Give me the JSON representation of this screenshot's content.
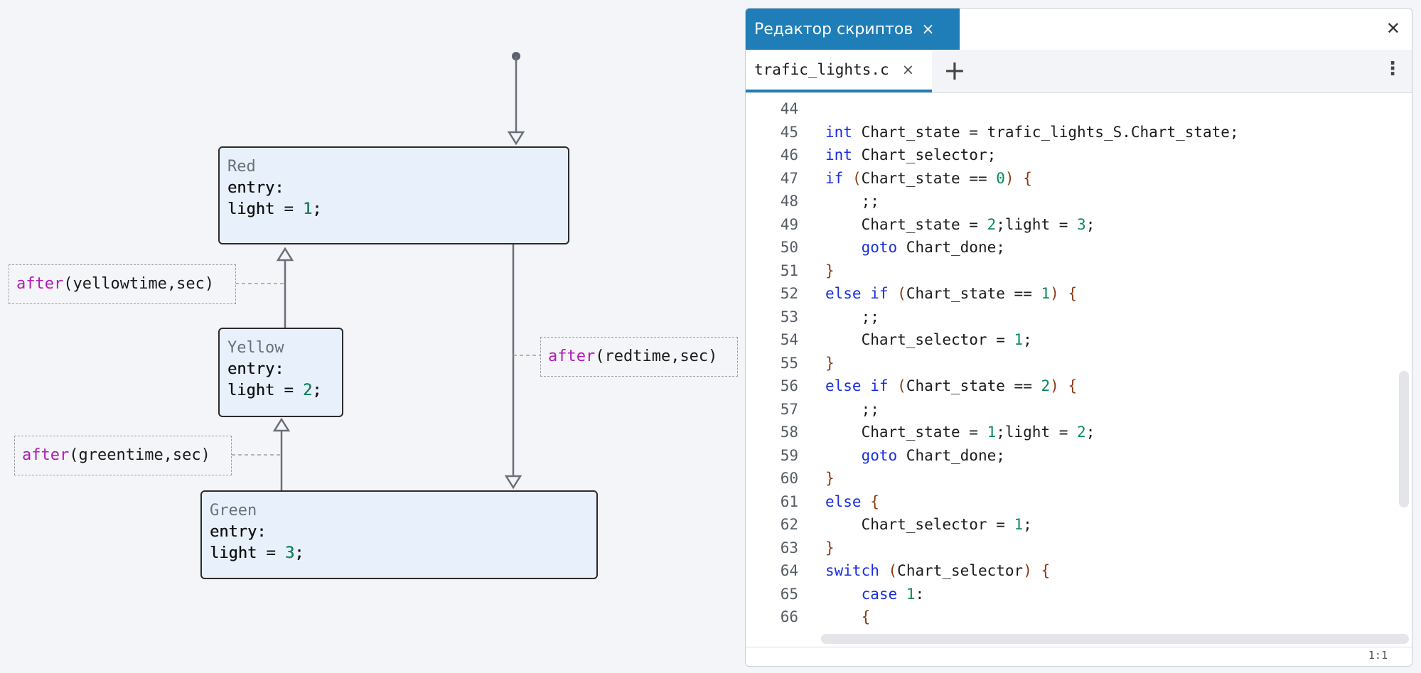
{
  "diagram": {
    "states": [
      {
        "name": "Red",
        "entry": "entry:",
        "action_prefix": "light = ",
        "action_value": "1",
        "action_suffix": ";"
      },
      {
        "name": "Yellow",
        "entry": "entry:",
        "action_prefix": "light = ",
        "action_value": "2",
        "action_suffix": ";"
      },
      {
        "name": "Green",
        "entry": "entry:",
        "action_prefix": "light = ",
        "action_value": "3",
        "action_suffix": ";"
      }
    ],
    "transitions": [
      {
        "keyword": "after",
        "args": "(yellowtime,sec)"
      },
      {
        "keyword": "after",
        "args": "(redtime,sec)"
      },
      {
        "keyword": "after",
        "args": "(greentime,sec)"
      }
    ]
  },
  "editor": {
    "title": "Редактор скриптов",
    "title_close_icon": "×",
    "window_close_icon": "✕",
    "file_tab": "trafic_lights.c",
    "file_tab_close_icon": "×",
    "add_tab_icon": "+",
    "menu_icon": "⋮",
    "cursor_position": "1:1",
    "lines": [
      {
        "n": "44",
        "tokens": []
      },
      {
        "n": "45",
        "tokens": [
          [
            "k",
            "int"
          ],
          [
            "t",
            " Chart_state = trafic_lights_S.Chart_state;"
          ]
        ]
      },
      {
        "n": "46",
        "tokens": [
          [
            "k",
            "int"
          ],
          [
            "t",
            " Chart_selector;"
          ]
        ]
      },
      {
        "n": "47",
        "tokens": [
          [
            "k",
            "if"
          ],
          [
            "t",
            " "
          ],
          [
            "p",
            "("
          ],
          [
            "t",
            "Chart_state == "
          ],
          [
            "n",
            "0"
          ],
          [
            "p",
            ")"
          ],
          [
            "t",
            " "
          ],
          [
            "p",
            "{"
          ]
        ]
      },
      {
        "n": "48",
        "tokens": [
          [
            "t",
            "    ;;"
          ]
        ]
      },
      {
        "n": "49",
        "tokens": [
          [
            "t",
            "    Chart_state = "
          ],
          [
            "n",
            "2"
          ],
          [
            "t",
            ";light = "
          ],
          [
            "n",
            "3"
          ],
          [
            "t",
            ";"
          ]
        ]
      },
      {
        "n": "50",
        "tokens": [
          [
            "t",
            "    "
          ],
          [
            "k",
            "goto"
          ],
          [
            "t",
            " Chart_done;"
          ]
        ]
      },
      {
        "n": "51",
        "tokens": [
          [
            "p",
            "}"
          ]
        ]
      },
      {
        "n": "52",
        "tokens": [
          [
            "k",
            "else if"
          ],
          [
            "t",
            " "
          ],
          [
            "p",
            "("
          ],
          [
            "t",
            "Chart_state == "
          ],
          [
            "n",
            "1"
          ],
          [
            "p",
            ")"
          ],
          [
            "t",
            " "
          ],
          [
            "p",
            "{"
          ]
        ]
      },
      {
        "n": "53",
        "tokens": [
          [
            "t",
            "    ;;"
          ]
        ]
      },
      {
        "n": "54",
        "tokens": [
          [
            "t",
            "    Chart_selector = "
          ],
          [
            "n",
            "1"
          ],
          [
            "t",
            ";"
          ]
        ]
      },
      {
        "n": "55",
        "tokens": [
          [
            "p",
            "}"
          ]
        ]
      },
      {
        "n": "56",
        "tokens": [
          [
            "k",
            "else if"
          ],
          [
            "t",
            " "
          ],
          [
            "p",
            "("
          ],
          [
            "t",
            "Chart_state == "
          ],
          [
            "n",
            "2"
          ],
          [
            "p",
            ")"
          ],
          [
            "t",
            " "
          ],
          [
            "p",
            "{"
          ]
        ]
      },
      {
        "n": "57",
        "tokens": [
          [
            "t",
            "    ;;"
          ]
        ]
      },
      {
        "n": "58",
        "tokens": [
          [
            "t",
            "    Chart_state = "
          ],
          [
            "n",
            "1"
          ],
          [
            "t",
            ";light = "
          ],
          [
            "n",
            "2"
          ],
          [
            "t",
            ";"
          ]
        ]
      },
      {
        "n": "59",
        "tokens": [
          [
            "t",
            "    "
          ],
          [
            "k",
            "goto"
          ],
          [
            "t",
            " Chart_done;"
          ]
        ]
      },
      {
        "n": "60",
        "tokens": [
          [
            "p",
            "}"
          ]
        ]
      },
      {
        "n": "61",
        "tokens": [
          [
            "k",
            "else"
          ],
          [
            "t",
            " "
          ],
          [
            "p",
            "{"
          ]
        ]
      },
      {
        "n": "62",
        "tokens": [
          [
            "t",
            "    Chart_selector = "
          ],
          [
            "n",
            "1"
          ],
          [
            "t",
            ";"
          ]
        ]
      },
      {
        "n": "63",
        "tokens": [
          [
            "p",
            "}"
          ]
        ]
      },
      {
        "n": "64",
        "tokens": [
          [
            "k",
            "switch"
          ],
          [
            "t",
            " "
          ],
          [
            "p",
            "("
          ],
          [
            "t",
            "Chart_selector"
          ],
          [
            "p",
            ")"
          ],
          [
            "t",
            " "
          ],
          [
            "p",
            "{"
          ]
        ]
      },
      {
        "n": "65",
        "tokens": [
          [
            "t",
            "    "
          ],
          [
            "k",
            "case"
          ],
          [
            "t",
            " "
          ],
          [
            "n",
            "1"
          ],
          [
            "t",
            ":"
          ]
        ]
      },
      {
        "n": "66",
        "tokens": [
          [
            "t",
            "    "
          ],
          [
            "p",
            "{"
          ]
        ]
      }
    ]
  }
}
